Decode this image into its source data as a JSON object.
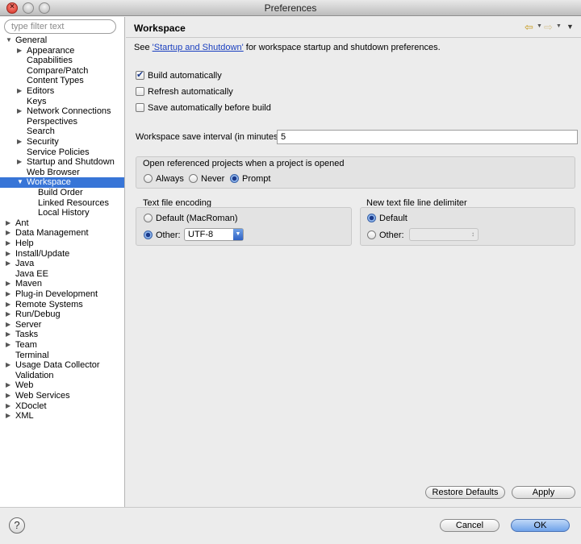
{
  "window": {
    "title": "Preferences"
  },
  "filter": {
    "placeholder": "type filter text"
  },
  "tree": [
    {
      "label": "General",
      "level": 0,
      "toggle": "open"
    },
    {
      "label": "Appearance",
      "level": 1,
      "toggle": "closed"
    },
    {
      "label": "Capabilities",
      "level": 1,
      "toggle": ""
    },
    {
      "label": "Compare/Patch",
      "level": 1,
      "toggle": ""
    },
    {
      "label": "Content Types",
      "level": 1,
      "toggle": ""
    },
    {
      "label": "Editors",
      "level": 1,
      "toggle": "closed"
    },
    {
      "label": "Keys",
      "level": 1,
      "toggle": ""
    },
    {
      "label": "Network Connections",
      "level": 1,
      "toggle": "closed"
    },
    {
      "label": "Perspectives",
      "level": 1,
      "toggle": ""
    },
    {
      "label": "Search",
      "level": 1,
      "toggle": ""
    },
    {
      "label": "Security",
      "level": 1,
      "toggle": "closed"
    },
    {
      "label": "Service Policies",
      "level": 1,
      "toggle": ""
    },
    {
      "label": "Startup and Shutdown",
      "level": 1,
      "toggle": "closed"
    },
    {
      "label": "Web Browser",
      "level": 1,
      "toggle": ""
    },
    {
      "label": "Workspace",
      "level": 1,
      "toggle": "open",
      "selected": true
    },
    {
      "label": "Build Order",
      "level": 2,
      "toggle": ""
    },
    {
      "label": "Linked Resources",
      "level": 2,
      "toggle": ""
    },
    {
      "label": "Local History",
      "level": 2,
      "toggle": ""
    },
    {
      "label": "Ant",
      "level": 0,
      "toggle": "closed"
    },
    {
      "label": "Data Management",
      "level": 0,
      "toggle": "closed"
    },
    {
      "label": "Help",
      "level": 0,
      "toggle": "closed"
    },
    {
      "label": "Install/Update",
      "level": 0,
      "toggle": "closed"
    },
    {
      "label": "Java",
      "level": 0,
      "toggle": "closed"
    },
    {
      "label": "Java EE",
      "level": 0,
      "toggle": ""
    },
    {
      "label": "Maven",
      "level": 0,
      "toggle": "closed"
    },
    {
      "label": "Plug-in Development",
      "level": 0,
      "toggle": "closed"
    },
    {
      "label": "Remote Systems",
      "level": 0,
      "toggle": "closed"
    },
    {
      "label": "Run/Debug",
      "level": 0,
      "toggle": "closed"
    },
    {
      "label": "Server",
      "level": 0,
      "toggle": "closed"
    },
    {
      "label": "Tasks",
      "level": 0,
      "toggle": "closed"
    },
    {
      "label": "Team",
      "level": 0,
      "toggle": "closed"
    },
    {
      "label": "Terminal",
      "level": 0,
      "toggle": ""
    },
    {
      "label": "Usage Data Collector",
      "level": 0,
      "toggle": "closed"
    },
    {
      "label": "Validation",
      "level": 0,
      "toggle": ""
    },
    {
      "label": "Web",
      "level": 0,
      "toggle": "closed"
    },
    {
      "label": "Web Services",
      "level": 0,
      "toggle": "closed"
    },
    {
      "label": "XDoclet",
      "level": 0,
      "toggle": "closed"
    },
    {
      "label": "XML",
      "level": 0,
      "toggle": "closed"
    }
  ],
  "page": {
    "title": "Workspace",
    "intro_prefix": "See ",
    "intro_link": "'Startup and Shutdown'",
    "intro_suffix": " for workspace startup and shutdown preferences.",
    "checkboxes": [
      {
        "label": "Build automatically",
        "checked": true
      },
      {
        "label": "Refresh automatically",
        "checked": false
      },
      {
        "label": "Save automatically before build",
        "checked": false
      }
    ],
    "save_interval_label": "Workspace save interval (in minutes):",
    "save_interval_value": "5",
    "open_projects": {
      "label": "Open referenced projects when a project is opened",
      "options": [
        "Always",
        "Never",
        "Prompt"
      ],
      "selected": "Prompt"
    },
    "encoding": {
      "label": "Text file encoding",
      "default_label": "Default (MacRoman)",
      "other_label": "Other:",
      "other_value": "UTF-8",
      "selected": "Other"
    },
    "delimiter": {
      "label": "New text file line delimiter",
      "default_label": "Default",
      "other_label": "Other:",
      "other_value": "",
      "selected": "Default"
    },
    "restore_defaults": "Restore Defaults",
    "apply": "Apply"
  },
  "footer": {
    "help_glyph": "?",
    "cancel": "Cancel",
    "ok": "OK"
  },
  "colors": {
    "selection": "#3875d7",
    "link": "#1a3fbf",
    "primary_button": "#6fa2ea"
  },
  "icons": {
    "back": "arrow-left-icon",
    "forward": "arrow-right-icon",
    "menu": "view-menu-icon",
    "help": "help-icon"
  }
}
